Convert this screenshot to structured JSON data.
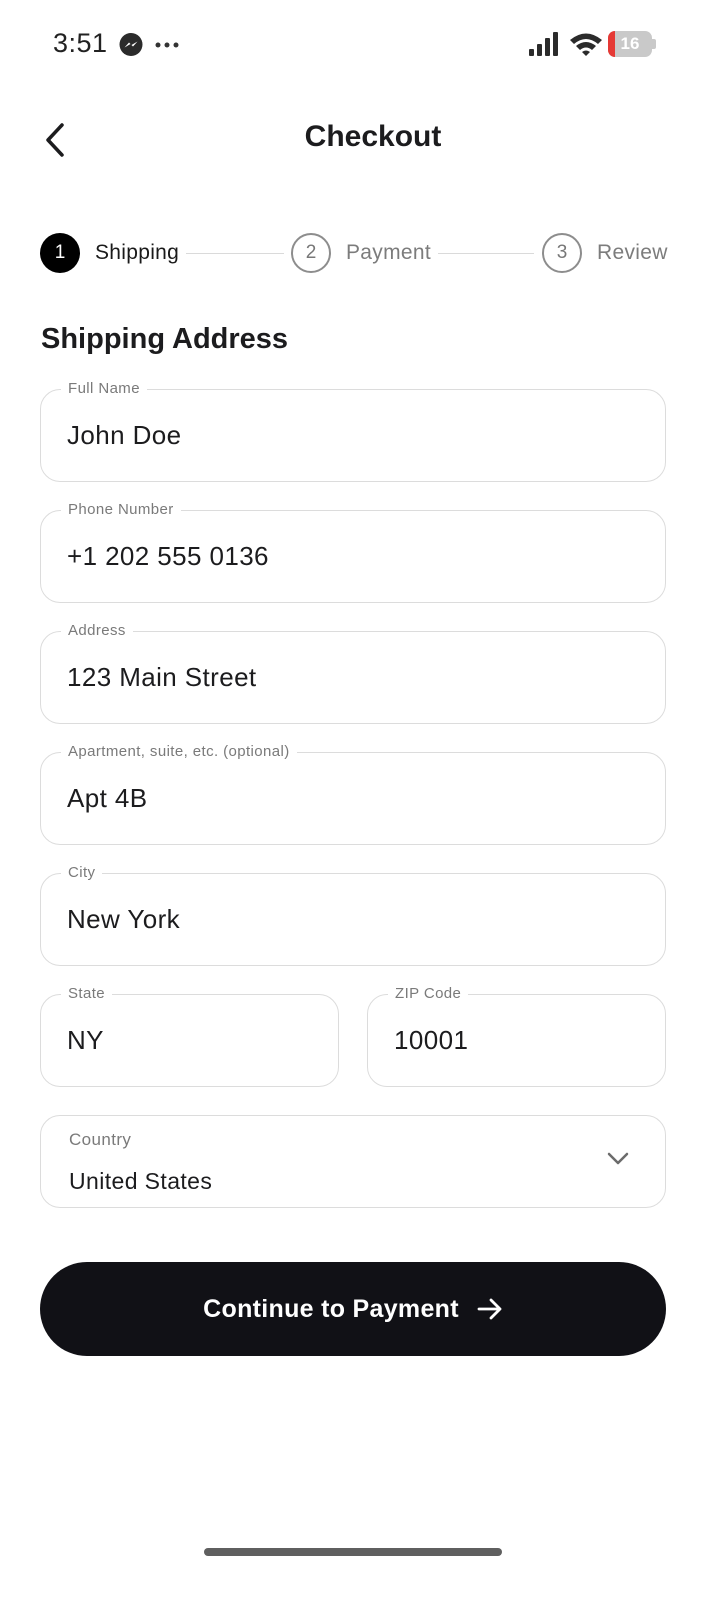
{
  "status_bar": {
    "time": "3:51",
    "battery_level": "16",
    "battery_fraction": 0.16,
    "battery_color": "#e53935",
    "icons": [
      "messenger-icon",
      "more-icon",
      "signal-icon",
      "wifi-icon",
      "battery-icon"
    ]
  },
  "header": {
    "title": "Checkout",
    "back_icon": "chevron-left-icon"
  },
  "stepper": {
    "steps": [
      {
        "number": "1",
        "label": "Shipping",
        "state": "active"
      },
      {
        "number": "2",
        "label": "Payment",
        "state": "inactive"
      },
      {
        "number": "3",
        "label": "Review",
        "state": "inactive"
      }
    ]
  },
  "form": {
    "section_title": "Shipping Address",
    "full_name": {
      "label": "Full Name",
      "value": "John Doe"
    },
    "phone": {
      "label": "Phone Number",
      "value": "+1 202 555 0136"
    },
    "address": {
      "label": "Address",
      "value": "123 Main Street"
    },
    "apartment": {
      "label": "Apartment, suite, etc. (optional)",
      "value": "Apt 4B"
    },
    "city": {
      "label": "City",
      "value": "New York"
    },
    "state": {
      "label": "State",
      "value": "NY"
    },
    "zip": {
      "label": "ZIP Code",
      "value": "10001"
    },
    "country": {
      "label": "Country",
      "value": "United States"
    }
  },
  "actions": {
    "continue_label": "Continue to Payment",
    "continue_icon": "arrow-right-icon"
  },
  "colors": {
    "primary": "#111116",
    "border": "#dcdcdc",
    "muted_text": "#7a7a7a"
  }
}
